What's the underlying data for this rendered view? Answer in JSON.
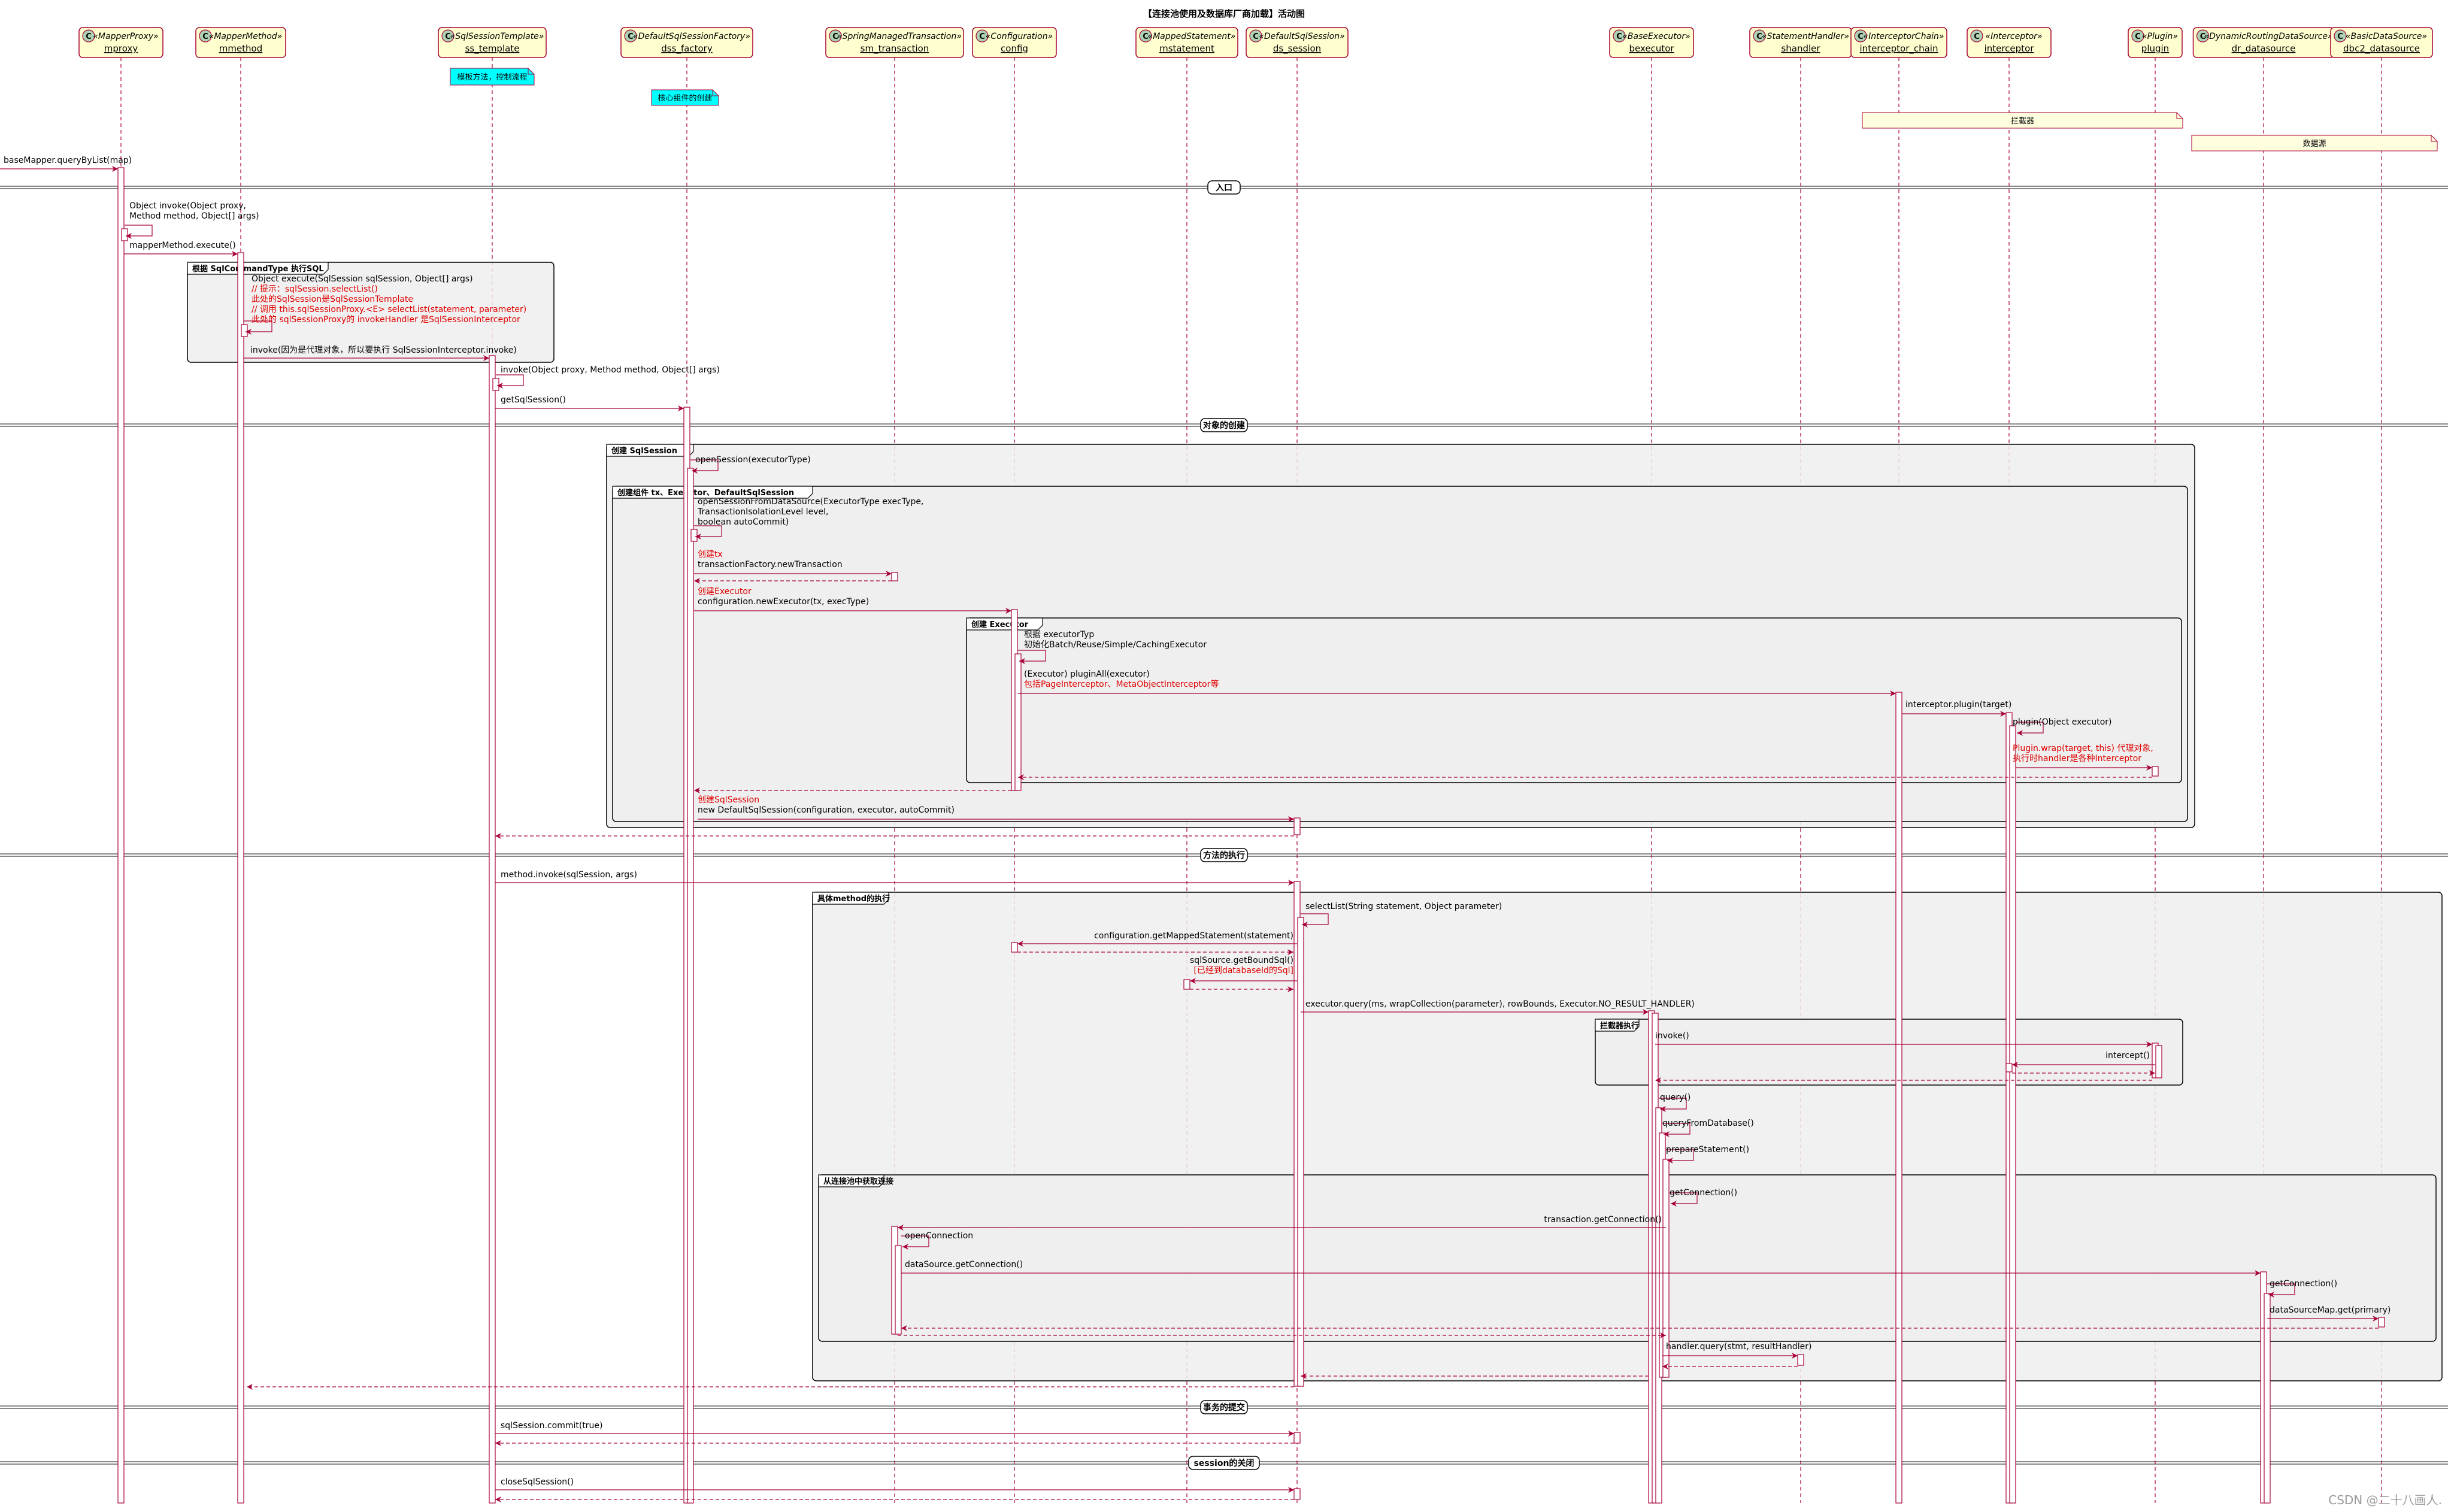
{
  "title": "【连接池使用及数据库厂商加载】活动图",
  "watermark": "CSDN @二十八画人.",
  "colors": {
    "participant_fill": "#fefece",
    "participant_border": "#a80036",
    "stereo_icon": "#add1b2",
    "line": "#a80036",
    "group_fill": "#eeeeee",
    "note_fill": "#fbfb77",
    "note_cyan": "#00ffff",
    "note_cream": "#ffffe0",
    "red_text": "#e00000"
  },
  "participants": [
    {
      "id": "mproxy",
      "stereo": "«MapperProxy»",
      "name": "mproxy"
    },
    {
      "id": "mmethod",
      "stereo": "«MapperMethod»",
      "name": "mmethod"
    },
    {
      "id": "ss_template",
      "stereo": "«SqlSessionTemplate»",
      "name": "ss_template"
    },
    {
      "id": "dss_factory",
      "stereo": "«DefaultSqlSessionFactory»",
      "name": "dss_factory"
    },
    {
      "id": "sm_transaction",
      "stereo": "«SpringManagedTransaction»",
      "name": "sm_transaction"
    },
    {
      "id": "config",
      "stereo": "«Configuration»",
      "name": "config"
    },
    {
      "id": "mstatement",
      "stereo": "«MappedStatement»",
      "name": "mstatement"
    },
    {
      "id": "ds_session",
      "stereo": "«DefaultSqlSession»",
      "name": "ds_session"
    },
    {
      "id": "bexecutor",
      "stereo": "«BaseExecutor»",
      "name": "bexecutor"
    },
    {
      "id": "shandler",
      "stereo": "«StatementHandler»",
      "name": "shandler"
    },
    {
      "id": "interceptor_chain",
      "stereo": "«InterceptorChain»",
      "name": "interceptor_chain"
    },
    {
      "id": "interceptor",
      "stereo": "«Interceptor»",
      "name": "interceptor"
    },
    {
      "id": "plugin",
      "stereo": "«Plugin»",
      "name": "plugin"
    },
    {
      "id": "dr_datasource",
      "stereo": "«DynamicRoutingDataSource»",
      "name": "dr_datasource"
    },
    {
      "id": "dbc2_datasource",
      "stereo": "«BasicDataSource»",
      "name": "dbc2_datasource"
    }
  ],
  "notes": [
    {
      "id": "n1",
      "text": "模板方法，控制流程"
    },
    {
      "id": "n2",
      "text": "核心组件的创建"
    },
    {
      "id": "n3",
      "text": "拦截器"
    },
    {
      "id": "n4",
      "text": "数据源"
    }
  ],
  "dividers": [
    {
      "id": "d1",
      "text": "入口"
    },
    {
      "id": "d2",
      "text": "对象的创建"
    },
    {
      "id": "d3",
      "text": "方法的执行"
    },
    {
      "id": "d4",
      "text": "事务的提交"
    },
    {
      "id": "d5",
      "text": "session的关闭"
    }
  ],
  "groups": [
    {
      "id": "g1",
      "title": "根据 SqlCommandType 执行SQL"
    },
    {
      "id": "g2",
      "title": "创建 SqlSession"
    },
    {
      "id": "g3",
      "title": "创建组件 tx、Executor、DefaultSqlSession"
    },
    {
      "id": "g4",
      "title": "创建 Executor"
    },
    {
      "id": "g5",
      "title": "具体method的执行"
    },
    {
      "id": "g6",
      "title": "拦截器执行"
    },
    {
      "id": "g7",
      "title": "从连接池中获取连接"
    }
  ],
  "messages": [
    {
      "id": "m1",
      "lines": [
        {
          "t": "baseMapper.queryByList(map)"
        }
      ]
    },
    {
      "id": "m2",
      "lines": [
        {
          "t": "Object invoke(Object proxy,"
        },
        {
          "t": "Method method, Object[] args)"
        }
      ]
    },
    {
      "id": "m3",
      "lines": [
        {
          "t": "mapperMethod.execute()"
        }
      ]
    },
    {
      "id": "m4",
      "lines": [
        {
          "t": "Object execute(SqlSession sqlSession, Object[] args)"
        },
        {
          "t": "// 提示：sqlSession.selectList()",
          "red": true
        },
        {
          "t": "此处的SqlSession是SqlSessionTemplate",
          "red": true
        },
        {
          "t": "// 调用 this.sqlSessionProxy.<E> selectList(statement, parameter)",
          "red": true
        },
        {
          "t": "此处的 sqlSessionProxy的 invokeHandler 是SqlSessionInterceptor",
          "red": true
        }
      ]
    },
    {
      "id": "m5",
      "lines": [
        {
          "t": "invoke(因为是代理对象，所以要执行 SqlSessionInterceptor.invoke)"
        }
      ]
    },
    {
      "id": "m6",
      "lines": [
        {
          "t": "invoke(Object proxy, Method method, Object[] args)"
        }
      ]
    },
    {
      "id": "m7",
      "lines": [
        {
          "t": "getSqlSession()"
        }
      ]
    },
    {
      "id": "m8",
      "lines": [
        {
          "t": "openSession(executorType)"
        }
      ]
    },
    {
      "id": "m9",
      "lines": [
        {
          "t": "openSessionFromDataSource(ExecutorType execType,"
        },
        {
          "t": "TransactionIsolationLevel level,"
        },
        {
          "t": "boolean autoCommit)"
        }
      ]
    },
    {
      "id": "m10",
      "lines": [
        {
          "t": "创建tx",
          "red": true
        },
        {
          "t": "transactionFactory.newTransaction"
        }
      ]
    },
    {
      "id": "m11",
      "lines": [
        {
          "t": "创建Executor",
          "red": true
        },
        {
          "t": "configuration.newExecutor(tx, execType)"
        }
      ]
    },
    {
      "id": "m12",
      "lines": [
        {
          "t": "根据 executorTyp"
        },
        {
          "t": "初始化Batch/Reuse/Simple/CachingExecutor"
        }
      ]
    },
    {
      "id": "m13",
      "lines": [
        {
          "t": "(Executor) pluginAll(executor)"
        },
        {
          "t": "包括PageInterceptor、MetaObjectInterceptor等",
          "red": true
        }
      ]
    },
    {
      "id": "m14",
      "lines": [
        {
          "t": "interceptor.plugin(target)"
        }
      ]
    },
    {
      "id": "m15",
      "lines": [
        {
          "t": "plugin(Object executor)"
        }
      ]
    },
    {
      "id": "m16",
      "lines": [
        {
          "t": "Plugin.wrap(target, this) 代理对象,",
          "red": true
        },
        {
          "t": "执行时handler是各种Interceptor",
          "red": true
        }
      ]
    },
    {
      "id": "m17",
      "lines": [
        {
          "t": "创建SqlSession",
          "red": true
        },
        {
          "t": "new DefaultSqlSession(configuration, executor, autoCommit)"
        }
      ]
    },
    {
      "id": "m18",
      "lines": [
        {
          "t": "method.invoke(sqlSession, args)"
        }
      ]
    },
    {
      "id": "m19",
      "lines": [
        {
          "t": "selectList(String statement, Object parameter)"
        }
      ]
    },
    {
      "id": "m20",
      "lines": [
        {
          "t": "configuration.getMappedStatement(statement)"
        }
      ]
    },
    {
      "id": "m21",
      "lines": [
        {
          "t": "sqlSource.getBoundSql()"
        },
        {
          "t": "[已经到databaseId的Sql]",
          "red": true
        }
      ]
    },
    {
      "id": "m22",
      "lines": [
        {
          "t": "executor.query(ms, wrapCollection(parameter), rowBounds, Executor.NO_RESULT_HANDLER)"
        }
      ]
    },
    {
      "id": "m23",
      "lines": [
        {
          "t": "invoke()"
        }
      ]
    },
    {
      "id": "m24",
      "lines": [
        {
          "t": "intercept()"
        }
      ]
    },
    {
      "id": "m25",
      "lines": [
        {
          "t": "query()"
        }
      ]
    },
    {
      "id": "m26",
      "lines": [
        {
          "t": "queryFromDatabase()"
        }
      ]
    },
    {
      "id": "m27",
      "lines": [
        {
          "t": "prepareStatement()"
        }
      ]
    },
    {
      "id": "m28",
      "lines": [
        {
          "t": "getConnection()"
        }
      ]
    },
    {
      "id": "m29",
      "lines": [
        {
          "t": "transaction.getConnection()"
        }
      ]
    },
    {
      "id": "m30",
      "lines": [
        {
          "t": "openConnection"
        }
      ]
    },
    {
      "id": "m31",
      "lines": [
        {
          "t": "dataSource.getConnection()"
        }
      ]
    },
    {
      "id": "m32",
      "lines": [
        {
          "t": "getConnection()"
        }
      ]
    },
    {
      "id": "m33",
      "lines": [
        {
          "t": "dataSourceMap.get(primary)"
        }
      ]
    },
    {
      "id": "m34",
      "lines": [
        {
          "t": "handler.query(stmt, resultHandler)"
        }
      ]
    },
    {
      "id": "m35",
      "lines": [
        {
          "t": "sqlSession.commit(true)"
        }
      ]
    },
    {
      "id": "m36",
      "lines": [
        {
          "t": "closeSqlSession()"
        }
      ]
    }
  ]
}
